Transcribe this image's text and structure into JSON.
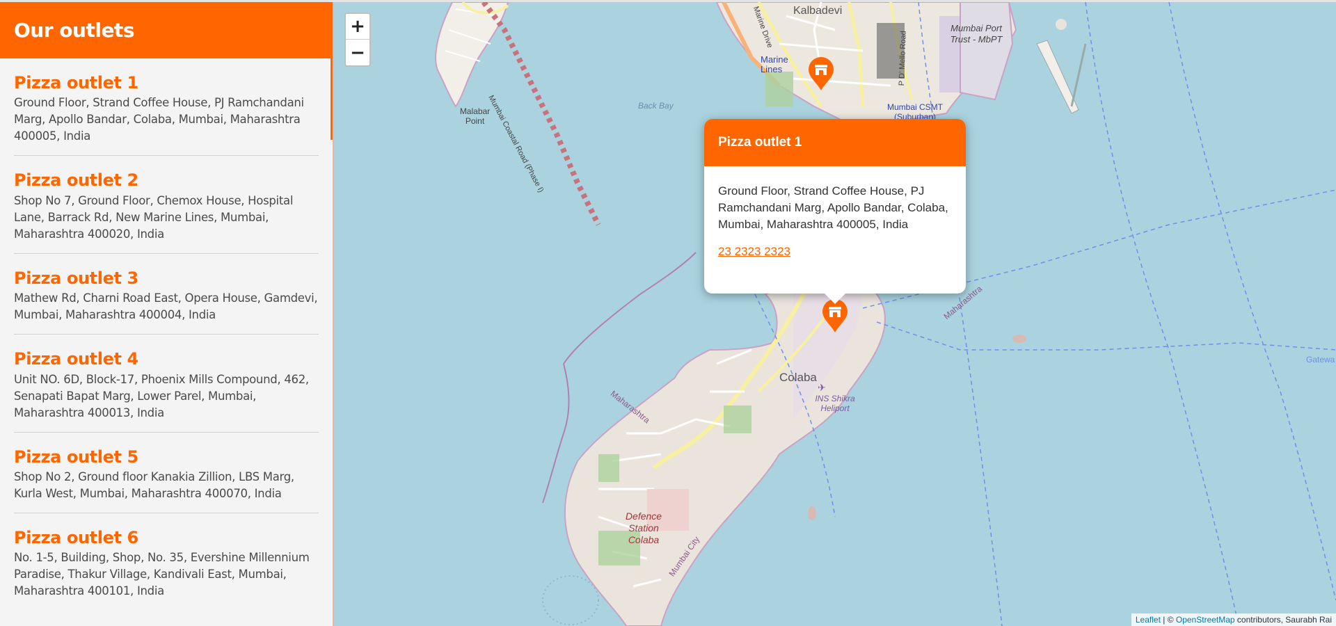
{
  "sidebar": {
    "title": "Our outlets",
    "outlets": [
      {
        "name": "Pizza outlet 1",
        "address": "Ground Floor, Strand Coffee House, PJ Ramchandani Marg, Apollo Bandar, Colaba, Mumbai, Maharashtra 400005, India"
      },
      {
        "name": "Pizza outlet 2",
        "address": "Shop No 7, Ground Floor, Chemox House, Hospital Lane, Barrack Rd, New Marine Lines, Mumbai, Maharashtra 400020, India"
      },
      {
        "name": "Pizza outlet 3",
        "address": "Mathew Rd, Charni Road East, Opera House, Gamdevi, Mumbai, Maharashtra 400004, India"
      },
      {
        "name": "Pizza outlet 4",
        "address": "Unit NO. 6D, Block-17, Phoenix Mills Compound, 462, Senapati Bapat Marg, Lower Parel, Mumbai, Maharashtra 400013, India"
      },
      {
        "name": "Pizza outlet 5",
        "address": "Shop No 2, Ground floor Kanakia Zillion, LBS Marg, Kurla West, Mumbai, Maharashtra 400070, India"
      },
      {
        "name": "Pizza outlet 6",
        "address": "No. 1-5, Building, Shop, No. 35, Evershine Millennium Paradise, Thakur Village, Kandivali East, Mumbai, Maharashtra 400101, India"
      }
    ]
  },
  "map": {
    "zoom_in_label": "+",
    "zoom_out_label": "−",
    "popup": {
      "title": "Pizza outlet 1",
      "address": "Ground Floor, Strand Coffee House, PJ Ramchandani Marg, Apollo Bandar, Colaba, Mumbai, Maharashtra 400005, India",
      "phone": "23 2323 2323"
    },
    "attribution": {
      "leaflet": "Leaflet",
      "separator": " | © ",
      "osm": "OpenStreetMap",
      "rest": " contributors, Saurabh Rai"
    },
    "labels": {
      "kalbadevi": "Kalbadevi",
      "marine_lines": "Marine Lines",
      "marine_drive": "Marine Drive",
      "mumbai_port_trust": "Mumbai Port Trust - MbPT",
      "csmt": "Mumbai CSMT (Suburban)",
      "malabar_point": "Malabar Point",
      "back_bay": "Back Bay",
      "coastal_road": "Mumbai Coastal Road (Phase I)",
      "colaba": "Colaba",
      "ins_shikra": "INS Shikra Heliport",
      "defence_station": "Defence Station Colaba",
      "maharashtra": "Maharashtra",
      "mumbai_city": "Mumbai City",
      "gateway": "Gatewa",
      "pd_mello": "P D' Mello Road"
    },
    "colors": {
      "accent": "#ff6600",
      "water": "#aad3df",
      "land": "#f2efe9"
    },
    "marker_icon": "shop-icon"
  }
}
